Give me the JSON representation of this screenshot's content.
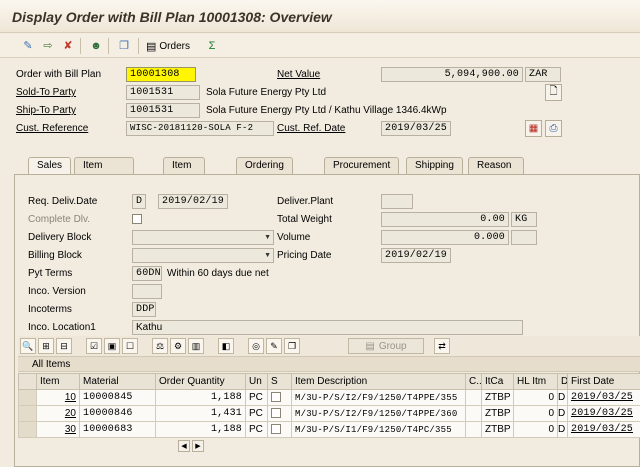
{
  "window": {
    "title": "Display Order with Bill Plan 10001308: Overview"
  },
  "toolbar": {
    "orders_label": "Orders",
    "icons": [
      "display-change-icon",
      "other-document-icon",
      "cancel-icon",
      "person-icon",
      "document-flow-icon",
      "orders-icon",
      "excel-icon"
    ]
  },
  "header": {
    "order_label": "Order with Bill Plan",
    "order_value": "10001308",
    "net_value_label": "Net Value",
    "net_value": "5,094,900.00",
    "currency": "ZAR",
    "sold_to_label": "Sold-To Party",
    "sold_to_value": "1001531",
    "sold_to_name": "Sola Future Energy Pty Ltd",
    "ship_to_label": "Ship-To Party",
    "ship_to_value": "1001531",
    "ship_to_name": "Sola Future Energy Pty Ltd / Kathu Village 1346.4kWp",
    "cust_ref_label": "Cust. Reference",
    "cust_ref_value": "WISC-20181120-SOLA F-2",
    "cust_ref_date_label": "Cust. Ref. Date",
    "cust_ref_date_value": "2019/03/25"
  },
  "tabs": [
    {
      "label": "Sales",
      "active": true
    },
    {
      "label": "Item Overview"
    },
    {
      "label": "Item detail"
    },
    {
      "label": "Ordering party"
    },
    {
      "label": "Procurement"
    },
    {
      "label": "Shipping"
    },
    {
      "label": "Reason for rejection"
    }
  ],
  "sales": {
    "req_deliv_label": "Req. Deliv.Date",
    "req_deliv_type": "D",
    "req_deliv_date": "2019/02/19",
    "deliver_plant_label": "Deliver.Plant",
    "deliver_plant_value": "",
    "complete_dlv_label": "Complete Dlv.",
    "total_weight_label": "Total Weight",
    "total_weight_value": "0.00",
    "weight_unit": "KG",
    "delivery_block_label": "Delivery Block",
    "delivery_block_value": "",
    "volume_label": "Volume",
    "volume_value": "0.000",
    "volume_unit": "",
    "billing_block_label": "Billing Block",
    "billing_block_value": "",
    "pricing_date_label": "Pricing Date",
    "pricing_date_value": "2019/02/19",
    "pyt_terms_label": "Pyt Terms",
    "pyt_terms_value": "60DN",
    "pyt_terms_text": "Within 60 days due net",
    "inco_version_label": "Inco. Version",
    "inco_version_value": "",
    "incoterms_label": "Incoterms",
    "incoterms_value": "DDP",
    "inco_location_label": "Inco. Location1",
    "inco_location_value": "Kathu"
  },
  "grid_toolbar": {
    "group_label": "Group"
  },
  "items_table": {
    "section_label": "All Items",
    "columns": [
      "Item",
      "Material",
      "Order Quantity",
      "Un",
      "S",
      "Item Description",
      "C..",
      "ItCa",
      "HL Itm",
      "D",
      "First Date"
    ],
    "rows": [
      {
        "item": "10",
        "material": "10000845",
        "qty": "1,188",
        "un": "PC",
        "desc": "M/3U-P/S/I2/F9/1250/T4PPE/355",
        "itca": "ZTBP",
        "hl": "0",
        "d": "D",
        "date": "2019/03/25"
      },
      {
        "item": "20",
        "material": "10000846",
        "qty": "1,431",
        "un": "PC",
        "desc": "M/3U-P/S/I2/F9/1250/T4PPE/360",
        "itca": "ZTBP",
        "hl": "0",
        "d": "D",
        "date": "2019/03/25"
      },
      {
        "item": "30",
        "material": "10000683",
        "qty": "1,188",
        "un": "PC",
        "desc": "M/3U-P/S/I1/F9/1250/T4PC/355",
        "itca": "ZTBP",
        "hl": "0",
        "d": "D",
        "date": "2019/03/25"
      }
    ]
  }
}
